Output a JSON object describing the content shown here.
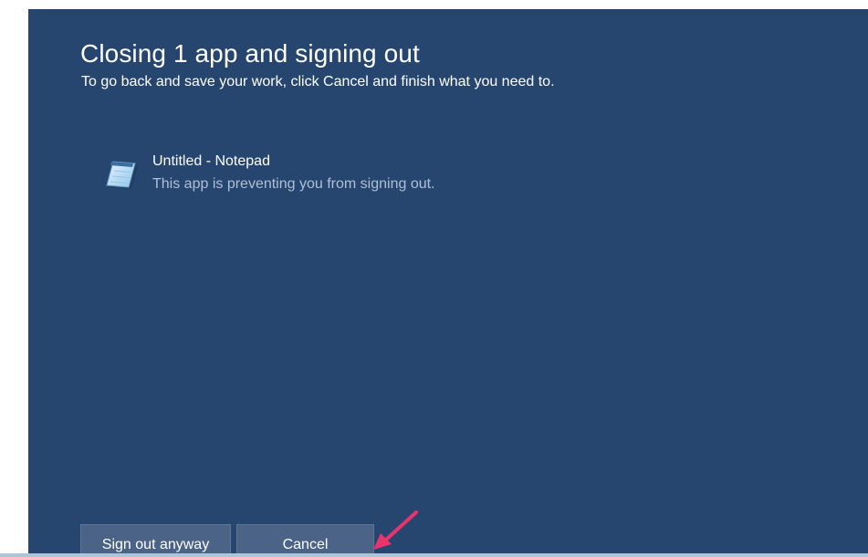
{
  "dialog": {
    "title": "Closing 1 app and signing out",
    "subtitle": "To go back and save your work, click Cancel and finish what you need to."
  },
  "app": {
    "icon": "notepad-icon",
    "name": "Untitled - Notepad",
    "status": "This app is preventing you from signing out."
  },
  "buttons": {
    "sign_out_label": "Sign out anyway",
    "cancel_label": "Cancel"
  },
  "annotation": {
    "icon": "pointer-arrow-icon",
    "color": "#e8336b"
  },
  "colors": {
    "dialog_background": "#27466f",
    "button_background": "#4a6386",
    "secondary_text": "#aebfd6"
  }
}
